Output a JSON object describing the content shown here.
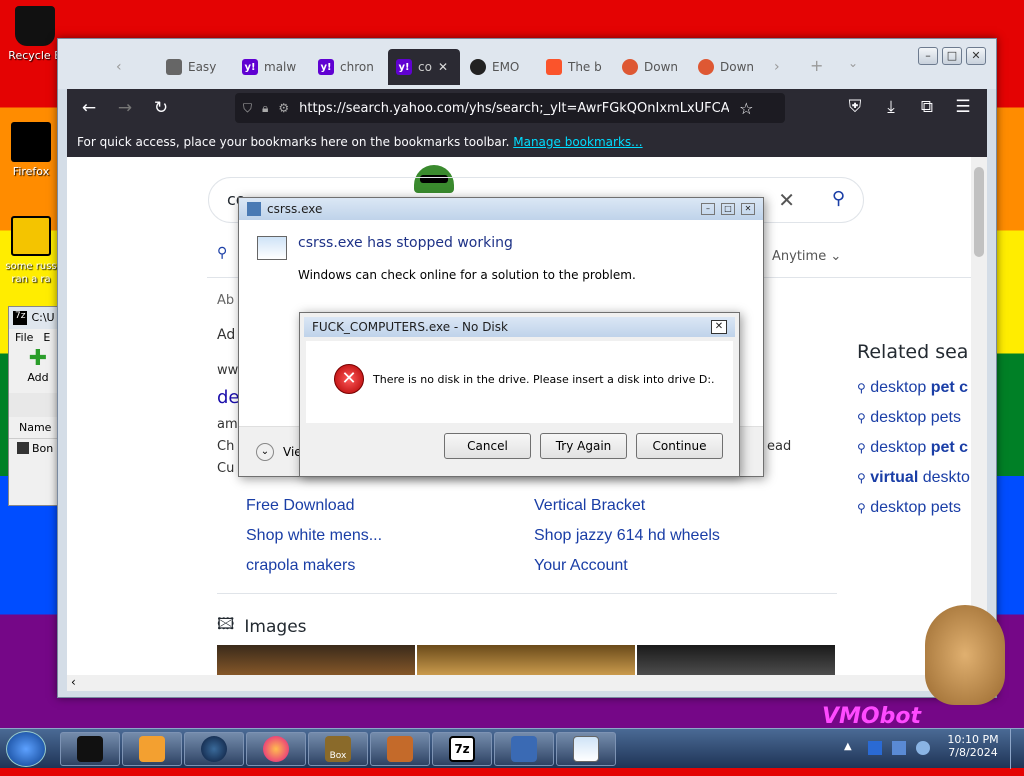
{
  "desktop": {
    "icons": [
      {
        "label": "Recycle B"
      },
      {
        "label": "Firefox"
      },
      {
        "label": "some russ ran a ra"
      }
    ]
  },
  "browser": {
    "tabs": [
      {
        "label": "Easy"
      },
      {
        "label": "malw"
      },
      {
        "label": "chron"
      },
      {
        "label": "co"
      },
      {
        "label": "EMO"
      },
      {
        "label": "The b"
      },
      {
        "label": "Down"
      },
      {
        "label": "Down"
      }
    ],
    "url": "https://search.yahoo.com/yhs/search;_ylt=AwrFGkQOnIxmLxUFCAgP",
    "bookmarks_text": "For quick access, place your bookmarks here on the bookmarks toolbar.",
    "bookmarks_link": "Manage bookmarks..."
  },
  "page": {
    "search_value": "co",
    "filter_label": "Anytime",
    "frag_ab": "Ab",
    "frag_ad": "Ad",
    "frag_www": "ww",
    "frag_de": "de",
    "frag_am": "am",
    "frag_ch": "Ch",
    "frag_cu": "Cu",
    "frag_ead": "ead",
    "suggestions_left": [
      "Free Download",
      "Shop white mens...",
      "crapola makers"
    ],
    "suggestions_right": [
      "Vertical Bracket",
      "Shop jazzy 614 hd wheels",
      "Your Account"
    ],
    "images_label": "Images",
    "related_title": "Related sea",
    "related": [
      {
        "pre": "desktop ",
        "bold": "pet c"
      },
      {
        "pre": "desktop pets",
        "bold": ""
      },
      {
        "pre": "desktop ",
        "bold": "pet c"
      },
      {
        "pre": "",
        "bold": "virtual",
        "post": " deskto"
      },
      {
        "pre": "desktop pets",
        "bold": ""
      }
    ]
  },
  "csrss_dialog": {
    "title": "csrss.exe",
    "heading": "csrss.exe has stopped working",
    "message": "Windows can check online for a solution to the problem.",
    "view_label": "Vie"
  },
  "nodisk_dialog": {
    "title": "FUCK_COMPUTERS.exe - No Disk",
    "message": "There is no disk in the drive. Please insert a disk into drive D:.",
    "buttons": {
      "cancel": "Cancel",
      "try_again": "Try Again",
      "continue": "Continue"
    }
  },
  "sevenzip": {
    "path": "C:\\U",
    "menu": [
      "File",
      "E"
    ],
    "add_label": "Add",
    "col_name": "Name",
    "row": "Bon"
  },
  "taskbar": {
    "time": "10:10 PM",
    "date": "7/8/2024",
    "box_label": "Box"
  },
  "overlay_text": "VMObot"
}
